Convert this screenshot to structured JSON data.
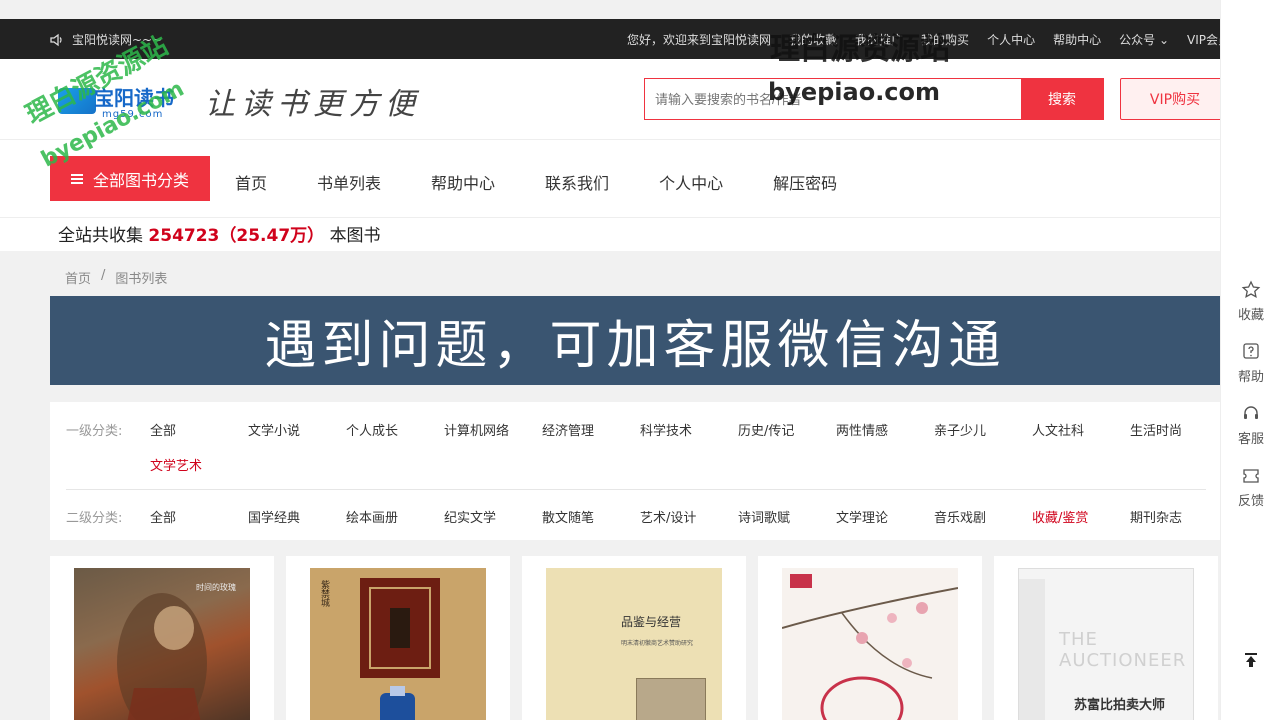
{
  "topbar": {
    "notice": "宝阳悦读网~~~",
    "greeting": "您好，欢迎来到宝阳悦读网",
    "links": [
      "我的收藏",
      "我的推广",
      "我的购买",
      "个人中心",
      "帮助中心",
      "公众号",
      "VIP会员"
    ]
  },
  "header": {
    "logo_name": "宝阳读书",
    "logo_domain": "mg59.com",
    "slogan": "让读书更方便",
    "search_placeholder": "请输入要搜索的书名/作者",
    "search_button": "搜索",
    "vip_button": "VIP购买"
  },
  "nav": {
    "category_button": "全部图书分类",
    "items": [
      "首页",
      "书单列表",
      "帮助中心",
      "联系我们",
      "个人中心",
      "解压密码"
    ]
  },
  "count": {
    "prefix": "全站共收集",
    "number": "254723（25.47万）",
    "suffix": "本图书"
  },
  "breadcrumb": {
    "home": "首页",
    "sep": "/",
    "current": "图书列表"
  },
  "banner": {
    "text": "遇到问题，可加客服微信沟通"
  },
  "filter": {
    "level1_label": "一级分类:",
    "level1": [
      "全部",
      "文学小说",
      "个人成长",
      "计算机网络",
      "经济管理",
      "科学技术",
      "历史/传记",
      "两性情感",
      "亲子少儿",
      "人文社科",
      "生活时尚",
      "文学艺术"
    ],
    "level1_active": "文学艺术",
    "level2_label": "二级分类:",
    "level2": [
      "全部",
      "国学经典",
      "绘本画册",
      "纪实文学",
      "散文随笔",
      "艺术/设计",
      "诗词歌赋",
      "文学理论",
      "音乐戏剧",
      "收藏/鉴赏",
      "期刊杂志"
    ],
    "level2_active": "收藏/鉴赏"
  },
  "books": [
    {
      "cover_title": "时间的玫瑰"
    },
    {
      "cover_title": "紫禁城"
    },
    {
      "cover_title": "品鉴与经营",
      "cover_subtitle": "明末清初徽商艺术赞助研究"
    },
    {
      "cover_title": ""
    },
    {
      "cover_title": "苏富比拍卖大师",
      "cover_en": "THE AUCTIONEER"
    }
  ],
  "sidebar": {
    "items": [
      "收藏",
      "帮助",
      "客服",
      "反馈"
    ]
  },
  "watermark": {
    "cn": "理白源资源站",
    "en": "byepiao.com"
  },
  "colors": {
    "accent": "#ef3340",
    "banner": "#3a5571",
    "topbar": "#222222"
  }
}
